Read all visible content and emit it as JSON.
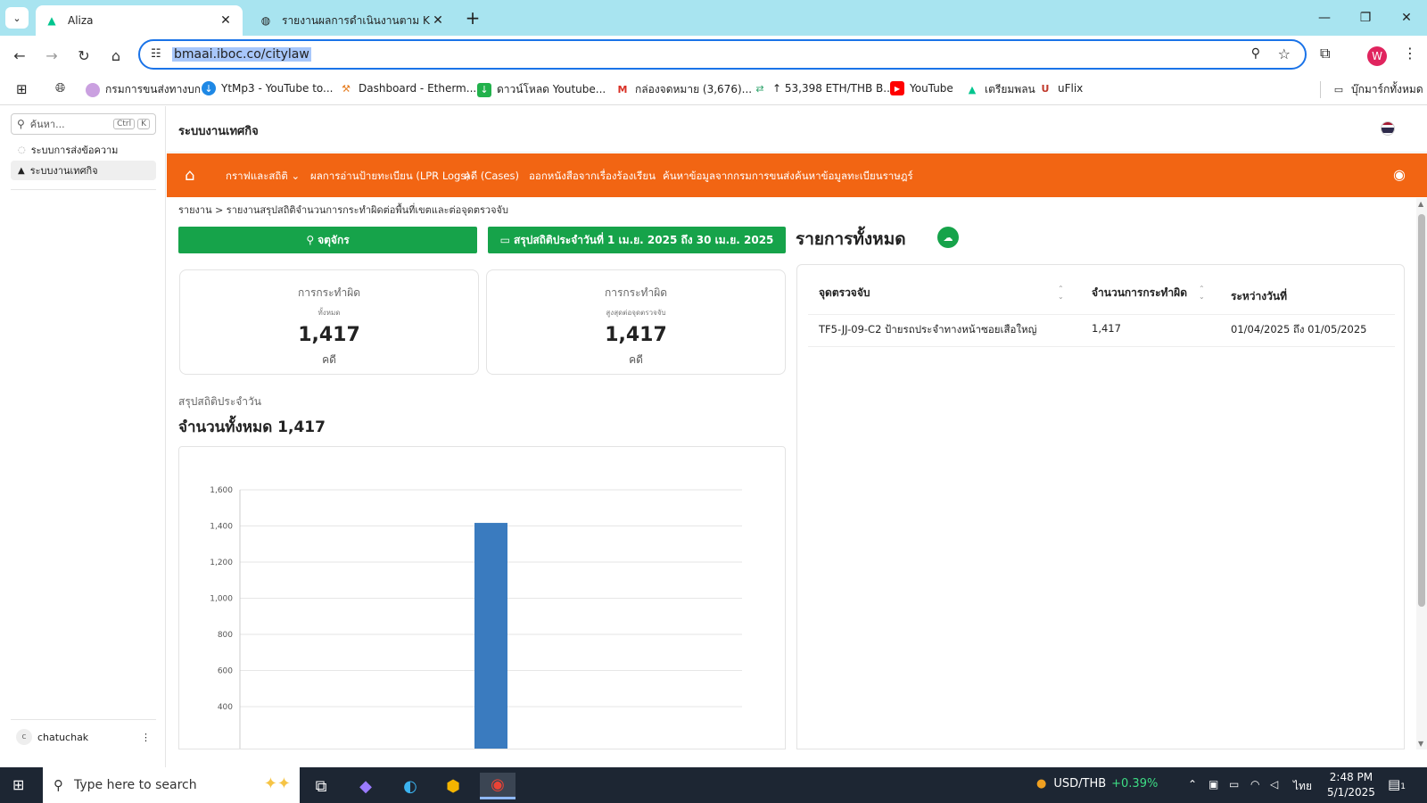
{
  "browser": {
    "tabs": [
      {
        "title": "Aliza",
        "icon": "nuxt-logo-icon"
      },
      {
        "title": "รายงานผลการดำเนินงานตาม KRs",
        "icon": "globe-icon"
      }
    ],
    "url": "bmaai.iboc.co/citylaw",
    "profile_initial": "W",
    "bookmarks": [
      "กรมการขนส่งทางบก",
      "YtMp3 - YouTube to...",
      "Dashboard - Etherm...",
      "ดาวน์โหลด Youtube...",
      "กล่องจดหมาย (3,676)...",
      "↑ 53,398 ETH/THB B...",
      "YouTube",
      "เตรียมพลน",
      "uFlix"
    ],
    "all_bookmarks": "บุ๊กมาร์กทั้งหมด"
  },
  "sidebar": {
    "search_placeholder": "ค้นหา...",
    "kbd_ctrl": "Ctrl",
    "kbd_k": "K",
    "items": [
      {
        "label": "ระบบการส่งข้อความ"
      },
      {
        "label": "ระบบงานเทศกิจ"
      }
    ],
    "user_initial": "c",
    "user_name": "chatuchak",
    "user_menu": "⋮"
  },
  "app": {
    "title": "ระบบงานเทศกิจ",
    "nav": [
      "กราฟและสถิติ",
      "ผลการอ่านป้ายทะเบียน (LPR Logs)",
      "คดี (Cases)",
      "ออกหนังสือจากเรื่องร้องเรียน",
      "ค้นหาข้อมูลจากกรมการขนส่ง",
      "ค้นหาข้อมูลทะเบียนราษฎร์"
    ],
    "breadcrumb": "รายงาน > รายงานสรุปสถิติจำนวนการกระทำผิดต่อพื้นที่เขตและต่อจุดตรวจจับ",
    "district_button": "จตุจักร",
    "date_button": "สรุปสถิติประจำวันที่ 1 เม.ย. 2025 ถึง 30 เม.ย. 2025",
    "cards": [
      {
        "title": "การกระทำผิด",
        "subtitle": "ทั้งหมด",
        "value": "1,417",
        "unit": "คดี"
      },
      {
        "title": "การกระทำผิด",
        "subtitle": "สูงสุดต่อจุดตรวจจับ",
        "value": "1,417",
        "unit": "คดี"
      }
    ],
    "daily_subtitle": "สรุปสถิติประจำวัน",
    "daily_total": "จำนวนทั้งหมด 1,417",
    "list_title": "รายการทั้งหมด",
    "table": {
      "headers": [
        "จุดตรวจจับ",
        "จำนวนการกระทำผิด",
        "ระหว่างวันที่"
      ],
      "rows": [
        [
          "TF5-JJ-09-C2 ป้ายรถประจำทางหน้าซอยเสือใหญ่",
          "1,417",
          "01/04/2025 ถึง 01/05/2025"
        ]
      ]
    }
  },
  "chart_data": {
    "type": "bar",
    "categories": [
      ""
    ],
    "values": [
      1417
    ],
    "ylim": [
      400,
      1600
    ],
    "yticks": [
      "400",
      "600",
      "800",
      "1,000",
      "1,200",
      "1,400",
      "1,600"
    ],
    "bar_color": "#3a7bbf",
    "grid": true
  },
  "taskbar": {
    "search_placeholder": "Type here to search",
    "currency": "USD/THB",
    "change": "+0.39%",
    "lang": "ไทย",
    "time": "2:48 PM",
    "date": "5/1/2025",
    "notification_count": "1"
  }
}
